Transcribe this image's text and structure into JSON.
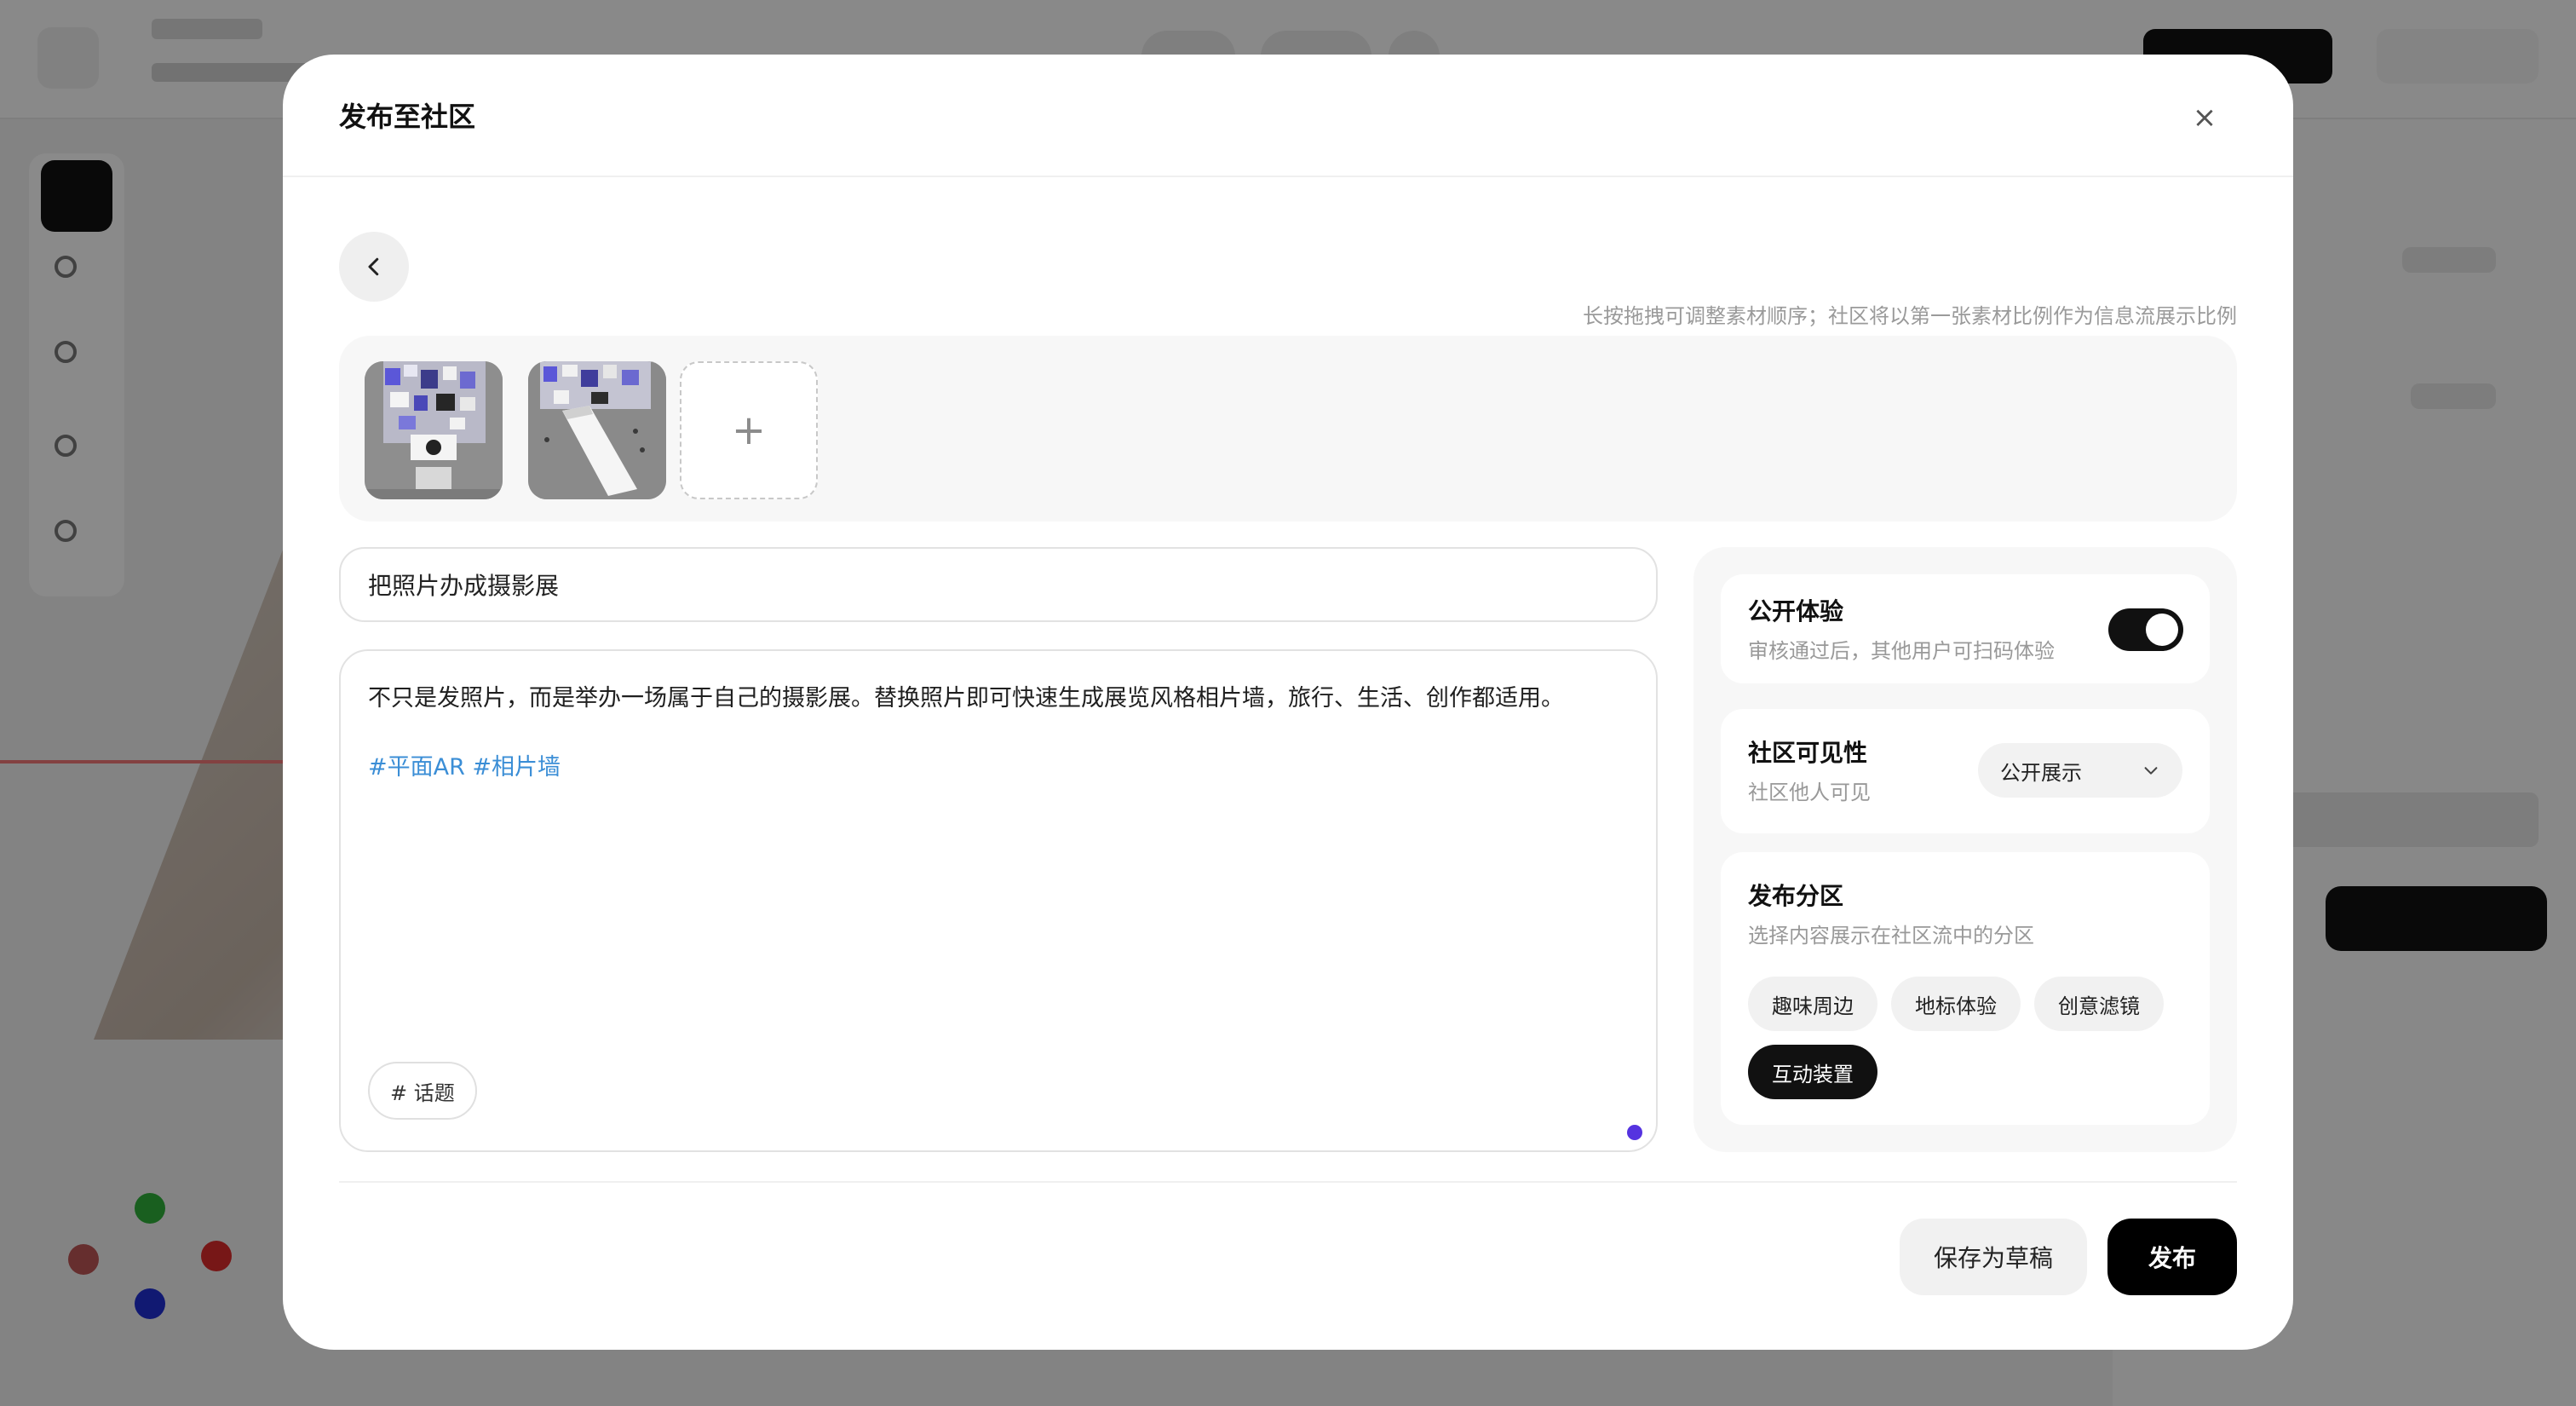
{
  "modal": {
    "title": "发布至社区",
    "close_glyph": "×",
    "hint": "长按拖拽可调整素材顺序；社区将以第一张素材比例作为信息流展示比例",
    "media": {
      "add_glyph": "+",
      "items": [
        {
          "name": "photo-wall-thumbnail-1"
        },
        {
          "name": "photo-wall-thumbnail-2"
        }
      ]
    },
    "title_field": {
      "value": "把照片办成摄影展"
    },
    "description": {
      "text": "不只是发照片，而是举办一场属于自己的摄影展。替换照片即可快速生成展览风格相片墙，旅行、生活、创作都适用。",
      "tags": "#平面AR #相片墙",
      "topic_button": "# 话题"
    },
    "settings": {
      "public_experience": {
        "title": "公开体验",
        "subtitle": "审核通过后，其他用户可扫码体验",
        "enabled": true
      },
      "visibility": {
        "title": "社区可见性",
        "subtitle": "社区他人可见",
        "selected": "公开展示"
      },
      "section": {
        "title": "发布分区",
        "subtitle": "选择内容展示在社区流中的分区",
        "options": [
          "趣味周边",
          "地标体验",
          "创意滤镜",
          "互动装置"
        ],
        "selected": "互动装置"
      }
    },
    "footer": {
      "draft_label": "保存为草稿",
      "publish_label": "发布"
    }
  },
  "colors": {
    "accent": "#111111",
    "tag_link": "#3b8ed6",
    "indicator": "#5533e0"
  }
}
